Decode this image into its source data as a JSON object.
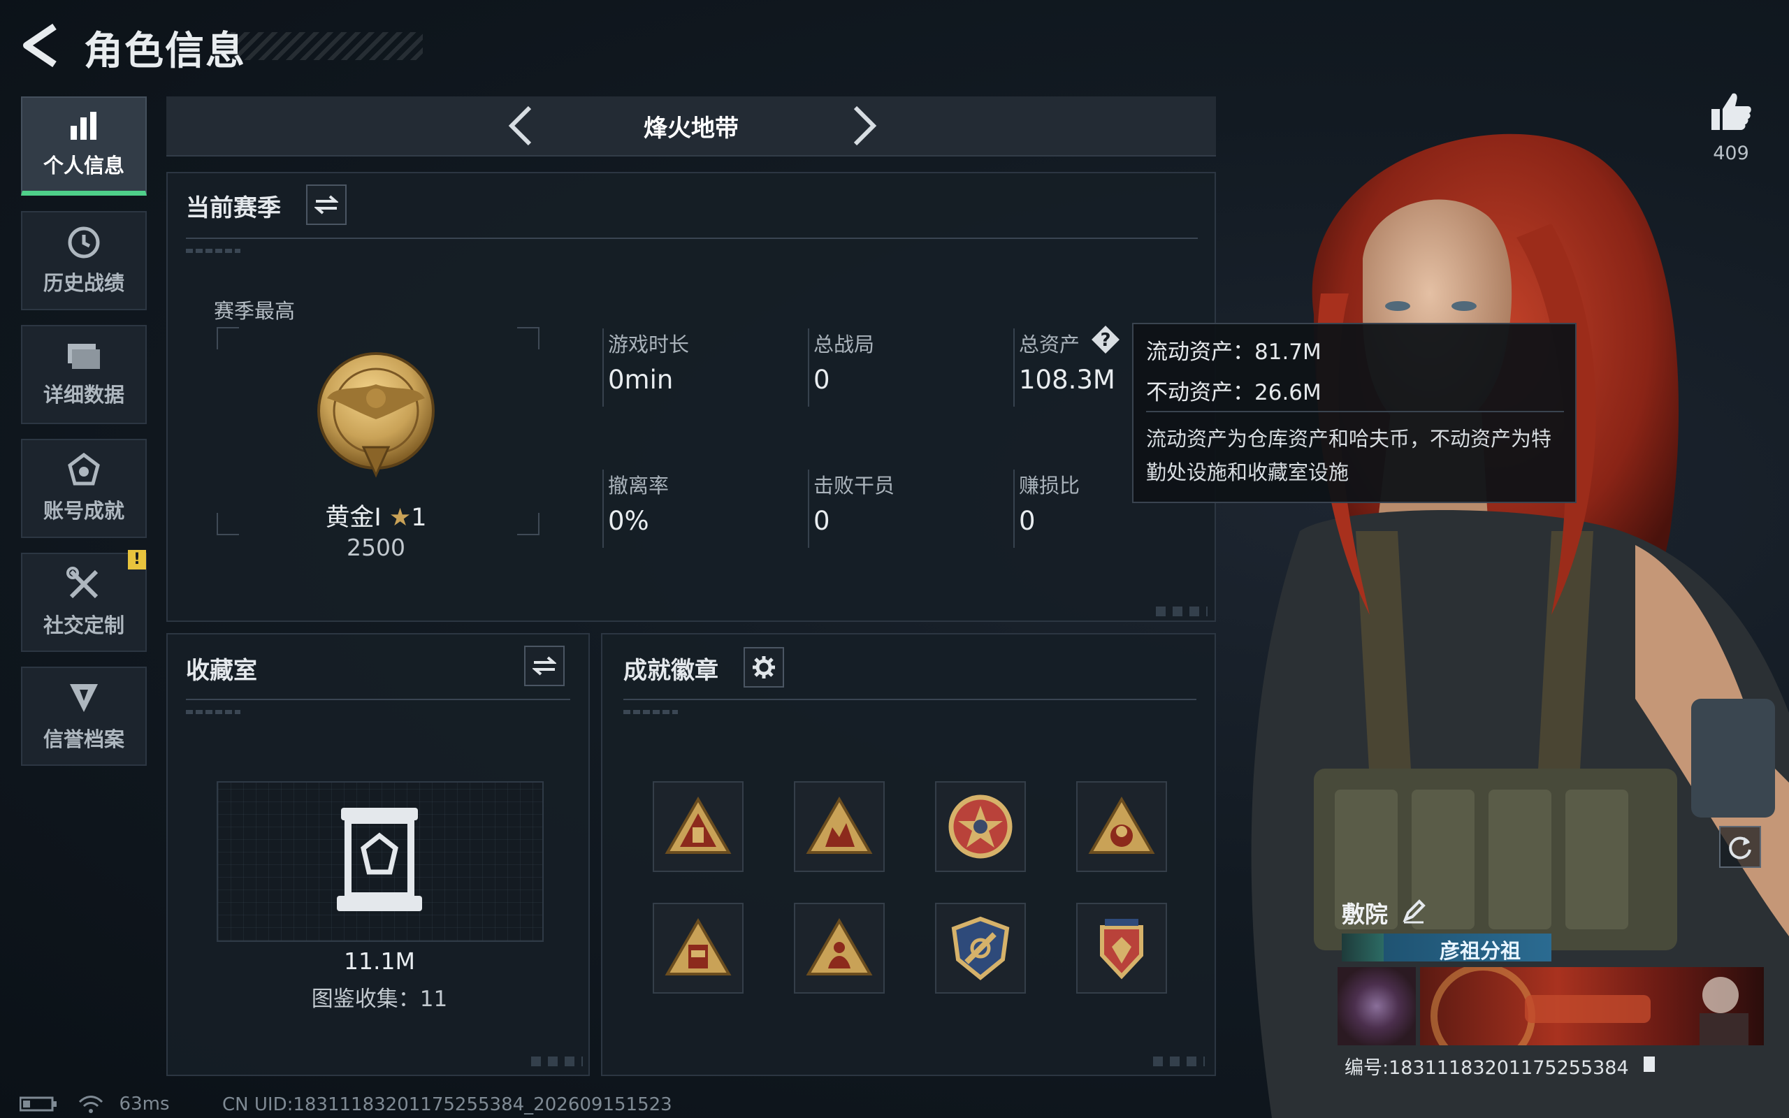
{
  "header": {
    "title": "角色信息"
  },
  "nav": {
    "items": [
      {
        "label": "个人信息",
        "icon": "bar-chart-icon",
        "active": true
      },
      {
        "label": "历史战绩",
        "icon": "clock-history-icon",
        "active": false
      },
      {
        "label": "详细数据",
        "icon": "folders-icon",
        "active": false
      },
      {
        "label": "账号成就",
        "icon": "achievement-icon",
        "active": false
      },
      {
        "label": "社交定制",
        "icon": "tools-icon",
        "active": false,
        "badge": "!"
      },
      {
        "label": "信誉档案",
        "icon": "shield-emblem-icon",
        "active": false
      }
    ]
  },
  "mode": {
    "title": "烽火地带"
  },
  "season": {
    "title": "当前赛季",
    "best_label": "赛季最高",
    "rank_name": "黄金I",
    "rank_stars": "1",
    "rank_points": "2500",
    "stats": [
      {
        "label": "游戏时长",
        "value": "0min"
      },
      {
        "label": "总战局",
        "value": "0"
      },
      {
        "label": "总资产",
        "value": "108.3M"
      },
      {
        "label": "撤离率",
        "value": "0%"
      },
      {
        "label": "击败干员",
        "value": "0"
      },
      {
        "label": "赚损比",
        "value": "0"
      }
    ]
  },
  "tooltip": {
    "liquid": "流动资产：81.7M",
    "fixed": "不动资产：26.6M",
    "note": "流动资产为仓库资产和哈夫币，不动资产为特勤处设施和收藏室设施"
  },
  "collection": {
    "title": "收藏室",
    "value": "11.1M",
    "count_text": "图鉴收集：11"
  },
  "badges": {
    "title": "成就徽章",
    "items": [
      "triangle-badge-icon",
      "triangle-badge-icon",
      "round-star-badge-icon",
      "triangle-badge-icon",
      "triangle-badge-icon",
      "triangle-badge-icon",
      "shield-badge-icon",
      "crest-badge-icon"
    ]
  },
  "profile": {
    "like_count": "409",
    "nickname": "敷院",
    "title_plate": "彦祖分祖",
    "card_uid": "编号:18311183201175255384"
  },
  "status": {
    "ping": "63ms",
    "cn_uid": "CN UID:18311183201175255384_202609151523"
  },
  "colors": {
    "accent_green": "#4fd08a",
    "gold": "#c9a257",
    "warning": "#e8c43d"
  }
}
